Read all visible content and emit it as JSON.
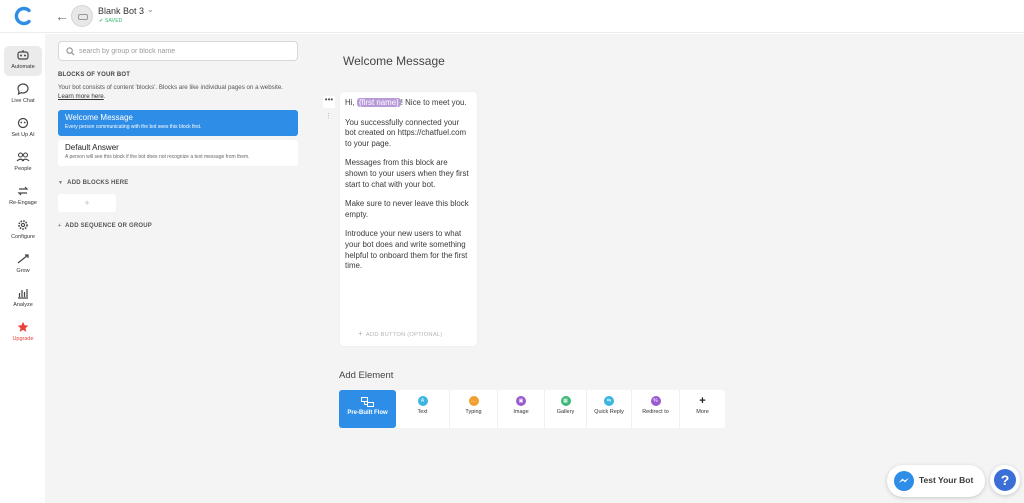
{
  "topbar": {
    "bot_name": "Blank Bot 3",
    "saved": "✔ SAVED",
    "back": "←",
    "chevron": "⌄"
  },
  "nav": [
    {
      "label": "Automate",
      "icon": "automate-icon"
    },
    {
      "label": "Live Chat",
      "icon": "live-chat-icon"
    },
    {
      "label": "Set Up AI",
      "icon": "ai-icon"
    },
    {
      "label": "People",
      "icon": "people-icon"
    },
    {
      "label": "Re-Engage",
      "icon": "re-engage-icon"
    },
    {
      "label": "Configure",
      "icon": "gear-icon"
    },
    {
      "label": "Grow",
      "icon": "grow-icon"
    },
    {
      "label": "Analyze",
      "icon": "analyze-icon"
    },
    {
      "label": "Upgrade",
      "icon": "star-icon"
    }
  ],
  "panel": {
    "search_placeholder": "search by group or block name",
    "section_title": "BLOCKS OF YOUR BOT",
    "desc": "Your bot consists of content 'blocks'. Blocks are like individual pages on a website. ",
    "learn_more": "Learn more here",
    "desc_end": ".",
    "blocks": [
      {
        "title": "Welcome Message",
        "sub": "Every person communicating with the bot sees this block first."
      },
      {
        "title": "Default Answer",
        "sub": "A person will see this block if the bot does not recognize a text message from them."
      }
    ],
    "add_blocks": "ADD BLOCKS HERE",
    "add_plus": "+",
    "add_sequence": "ADD SEQUENCE OR GROUP"
  },
  "main": {
    "title": "Welcome Message",
    "dots": "•••",
    "drag": "⋮",
    "hi": "Hi, ",
    "chip": "{first name}",
    "hi_rest": "! Nice to meet you.",
    "p2": "You successfully connected your bot created on https://chatfuel.com to your page.",
    "p3": "Messages from this block are shown to your users when they first start to chat with your bot.",
    "p4": "Make sure to never leave this block empty.",
    "p5": "Introduce your new users to what your bot does and write something helpful to onboard them for the first time.",
    "add_button": "ADD BUTTON (OPTIONAL)",
    "add_button_plus": "+",
    "add_element": "Add Element",
    "elements": [
      {
        "label": "Pre-Built Flow",
        "glyph": ""
      },
      {
        "label": "Text",
        "glyph": "A",
        "color": "#3ab6e0"
      },
      {
        "label": "Typing",
        "glyph": "…",
        "color": "#f0a030"
      },
      {
        "label": "Image",
        "glyph": "▣",
        "color": "#9b59d0"
      },
      {
        "label": "Gallery",
        "glyph": "▦",
        "color": "#3cb878"
      },
      {
        "label": "Quick Reply",
        "glyph": "⇆",
        "color": "#3ab6e0"
      },
      {
        "label": "Redirect to",
        "glyph": "%",
        "color": "#9b59d0"
      },
      {
        "label": "More",
        "glyph": "+"
      }
    ],
    "test_bot": "Test Your Bot",
    "help": "?"
  },
  "colors": {
    "accent": "#2e8de6",
    "panel_bg": "#f4f4f4",
    "upgrade": "#e8413c",
    "chip": "#b99ad8"
  }
}
